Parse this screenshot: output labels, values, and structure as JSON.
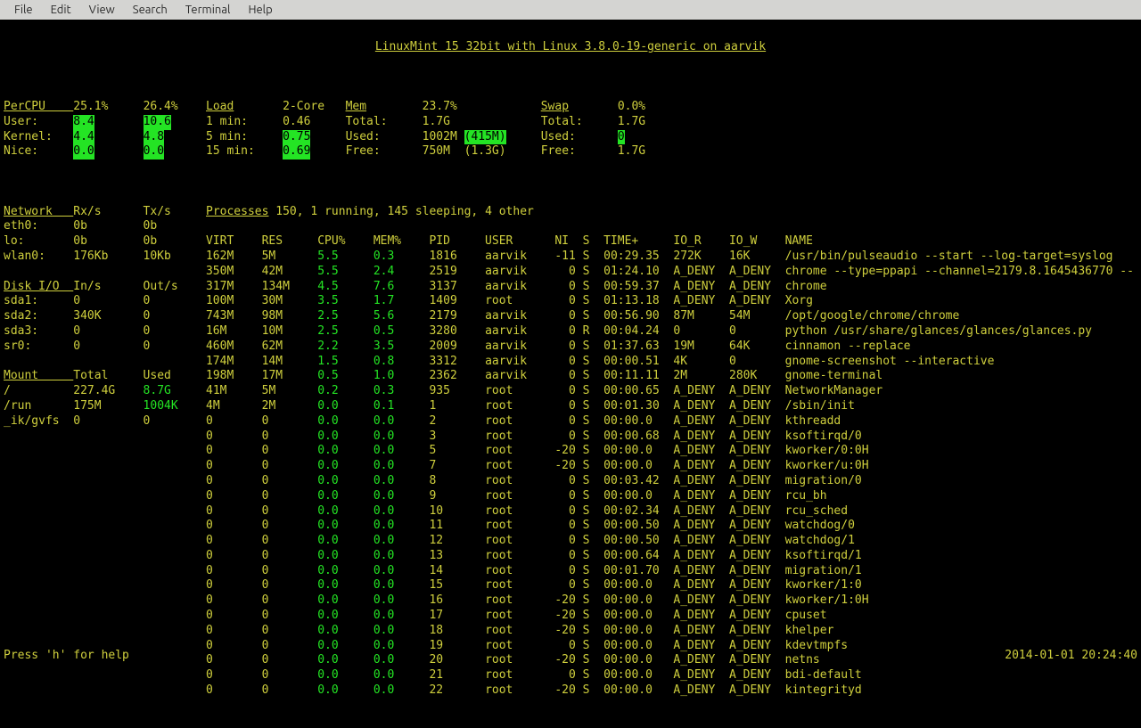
{
  "menubar": [
    "File",
    "Edit",
    "View",
    "Search",
    "Terminal",
    "Help"
  ],
  "title": "LinuxMint 15 32bit with Linux 3.8.0-19-generic on aarvik",
  "percpu": {
    "label": "PerCPU",
    "vals": [
      "25.1%",
      "26.4%"
    ],
    "user": {
      "label": "User:",
      "v": [
        "8.4",
        "10.6"
      ]
    },
    "kernel": {
      "label": "Kernel:",
      "v": [
        "4.4",
        "4.8"
      ]
    },
    "nice": {
      "label": "Nice:",
      "v": [
        "0.0",
        "0.0"
      ]
    }
  },
  "load": {
    "label": "Load",
    "core": "2-Core",
    "m1": {
      "l": "1 min:",
      "v": "0.46"
    },
    "m5": {
      "l": "5 min:",
      "v": "0.75"
    },
    "m15": {
      "l": "15 min:",
      "v": "0.69"
    }
  },
  "mem": {
    "label": "Mem",
    "pct": "23.7%",
    "total": {
      "l": "Total:",
      "v": "1.7G"
    },
    "used": {
      "l": "Used:",
      "v": "1002M",
      "p": "(415M)"
    },
    "free": {
      "l": "Free:",
      "v": "750M",
      "p": "(1.3G)"
    }
  },
  "swap": {
    "label": "Swap",
    "pct": "0.0%",
    "total": {
      "l": "Total:",
      "v": "1.7G"
    },
    "used": {
      "l": "Used:",
      "v": "0"
    },
    "free": {
      "l": "Free:",
      "v": "1.7G"
    }
  },
  "network": {
    "label": "Network",
    "rx": "Rx/s",
    "tx": "Tx/s",
    "rows": [
      [
        "eth0:",
        "0b",
        "0b"
      ],
      [
        "lo:",
        "0b",
        "0b"
      ],
      [
        "wlan0:",
        "176Kb",
        "10Kb"
      ]
    ]
  },
  "diskio": {
    "label": "Disk I/O",
    "in": "In/s",
    "out": "Out/s",
    "rows": [
      [
        "sda1:",
        "0",
        "0"
      ],
      [
        "sda2:",
        "340K",
        "0"
      ],
      [
        "sda3:",
        "0",
        "0"
      ],
      [
        "sr0:",
        "0",
        "0"
      ]
    ]
  },
  "mount": {
    "label": "Mount",
    "total": "Total",
    "used": "Used",
    "rows": [
      [
        "/",
        "227.4G",
        "8.7G",
        true
      ],
      [
        "/run",
        "175M",
        "1004K",
        true
      ],
      [
        "_ik/gvfs",
        "0",
        "0",
        false
      ]
    ]
  },
  "processes": {
    "label": "Processes",
    "summary": "150, 1 running, 145 sleeping, 4 other",
    "headers": [
      "VIRT",
      "RES",
      "CPU%",
      "MEM%",
      "PID",
      "USER",
      "NI",
      "S",
      "TIME+",
      "IO_R",
      "IO_W",
      "NAME"
    ],
    "rows": [
      [
        "162M",
        "5M",
        "5.5",
        "0.3",
        "1816",
        "aarvik",
        "-11",
        "S",
        "00:29.35",
        "272K",
        "16K",
        "/usr/bin/pulseaudio --start --log-target=syslog"
      ],
      [
        "350M",
        "42M",
        "5.5",
        "2.4",
        "2519",
        "aarvik",
        "0",
        "S",
        "01:24.10",
        "A_DENY",
        "A_DENY",
        "chrome --type=ppapi --channel=2179.8.1645436770 --"
      ],
      [
        "317M",
        "134M",
        "4.5",
        "7.6",
        "3137",
        "aarvik",
        "0",
        "S",
        "00:59.37",
        "A_DENY",
        "A_DENY",
        "chrome"
      ],
      [
        "100M",
        "30M",
        "3.5",
        "1.7",
        "1409",
        "root",
        "0",
        "S",
        "01:13.18",
        "A_DENY",
        "A_DENY",
        "Xorg"
      ],
      [
        "743M",
        "98M",
        "2.5",
        "5.6",
        "2179",
        "aarvik",
        "0",
        "S",
        "00:56.90",
        "87M",
        "54M",
        "/opt/google/chrome/chrome"
      ],
      [
        "16M",
        "10M",
        "2.5",
        "0.5",
        "3280",
        "aarvik",
        "0",
        "R",
        "00:04.24",
        "0",
        "0",
        "python /usr/share/glances/glances/glances.py"
      ],
      [
        "460M",
        "62M",
        "2.2",
        "3.5",
        "2009",
        "aarvik",
        "0",
        "S",
        "01:37.63",
        "19M",
        "64K",
        "cinnamon --replace"
      ],
      [
        "174M",
        "14M",
        "1.5",
        "0.8",
        "3312",
        "aarvik",
        "0",
        "S",
        "00:00.51",
        "4K",
        "0",
        "gnome-screenshot --interactive"
      ],
      [
        "198M",
        "17M",
        "0.5",
        "1.0",
        "2362",
        "aarvik",
        "0",
        "S",
        "00:11.11",
        "2M",
        "280K",
        "gnome-terminal"
      ],
      [
        "41M",
        "5M",
        "0.2",
        "0.3",
        "935",
        "root",
        "0",
        "S",
        "00:00.65",
        "A_DENY",
        "A_DENY",
        "NetworkManager"
      ],
      [
        "4M",
        "2M",
        "0.0",
        "0.1",
        "1",
        "root",
        "0",
        "S",
        "00:01.30",
        "A_DENY",
        "A_DENY",
        "/sbin/init"
      ],
      [
        "0",
        "0",
        "0.0",
        "0.0",
        "2",
        "root",
        "0",
        "S",
        "00:00.0",
        "A_DENY",
        "A_DENY",
        "kthreadd"
      ],
      [
        "0",
        "0",
        "0.0",
        "0.0",
        "3",
        "root",
        "0",
        "S",
        "00:00.68",
        "A_DENY",
        "A_DENY",
        "ksoftirqd/0"
      ],
      [
        "0",
        "0",
        "0.0",
        "0.0",
        "5",
        "root",
        "-20",
        "S",
        "00:00.0",
        "A_DENY",
        "A_DENY",
        "kworker/0:0H"
      ],
      [
        "0",
        "0",
        "0.0",
        "0.0",
        "7",
        "root",
        "-20",
        "S",
        "00:00.0",
        "A_DENY",
        "A_DENY",
        "kworker/u:0H"
      ],
      [
        "0",
        "0",
        "0.0",
        "0.0",
        "8",
        "root",
        "0",
        "S",
        "00:03.42",
        "A_DENY",
        "A_DENY",
        "migration/0"
      ],
      [
        "0",
        "0",
        "0.0",
        "0.0",
        "9",
        "root",
        "0",
        "S",
        "00:00.0",
        "A_DENY",
        "A_DENY",
        "rcu_bh"
      ],
      [
        "0",
        "0",
        "0.0",
        "0.0",
        "10",
        "root",
        "0",
        "S",
        "00:02.34",
        "A_DENY",
        "A_DENY",
        "rcu_sched"
      ],
      [
        "0",
        "0",
        "0.0",
        "0.0",
        "11",
        "root",
        "0",
        "S",
        "00:00.50",
        "A_DENY",
        "A_DENY",
        "watchdog/0"
      ],
      [
        "0",
        "0",
        "0.0",
        "0.0",
        "12",
        "root",
        "0",
        "S",
        "00:00.50",
        "A_DENY",
        "A_DENY",
        "watchdog/1"
      ],
      [
        "0",
        "0",
        "0.0",
        "0.0",
        "13",
        "root",
        "0",
        "S",
        "00:00.64",
        "A_DENY",
        "A_DENY",
        "ksoftirqd/1"
      ],
      [
        "0",
        "0",
        "0.0",
        "0.0",
        "14",
        "root",
        "0",
        "S",
        "00:01.70",
        "A_DENY",
        "A_DENY",
        "migration/1"
      ],
      [
        "0",
        "0",
        "0.0",
        "0.0",
        "15",
        "root",
        "0",
        "S",
        "00:00.0",
        "A_DENY",
        "A_DENY",
        "kworker/1:0"
      ],
      [
        "0",
        "0",
        "0.0",
        "0.0",
        "16",
        "root",
        "-20",
        "S",
        "00:00.0",
        "A_DENY",
        "A_DENY",
        "kworker/1:0H"
      ],
      [
        "0",
        "0",
        "0.0",
        "0.0",
        "17",
        "root",
        "-20",
        "S",
        "00:00.0",
        "A_DENY",
        "A_DENY",
        "cpuset"
      ],
      [
        "0",
        "0",
        "0.0",
        "0.0",
        "18",
        "root",
        "-20",
        "S",
        "00:00.0",
        "A_DENY",
        "A_DENY",
        "khelper"
      ],
      [
        "0",
        "0",
        "0.0",
        "0.0",
        "19",
        "root",
        "0",
        "S",
        "00:00.0",
        "A_DENY",
        "A_DENY",
        "kdevtmpfs"
      ],
      [
        "0",
        "0",
        "0.0",
        "0.0",
        "20",
        "root",
        "-20",
        "S",
        "00:00.0",
        "A_DENY",
        "A_DENY",
        "netns"
      ],
      [
        "0",
        "0",
        "0.0",
        "0.0",
        "21",
        "root",
        "0",
        "S",
        "00:00.0",
        "A_DENY",
        "A_DENY",
        "bdi-default"
      ],
      [
        "0",
        "0",
        "0.0",
        "0.0",
        "22",
        "root",
        "-20",
        "S",
        "00:00.0",
        "A_DENY",
        "A_DENY",
        "kintegrityd"
      ]
    ]
  },
  "help": "Press 'h' for help",
  "timestamp": "2014-01-01 20:24:40"
}
